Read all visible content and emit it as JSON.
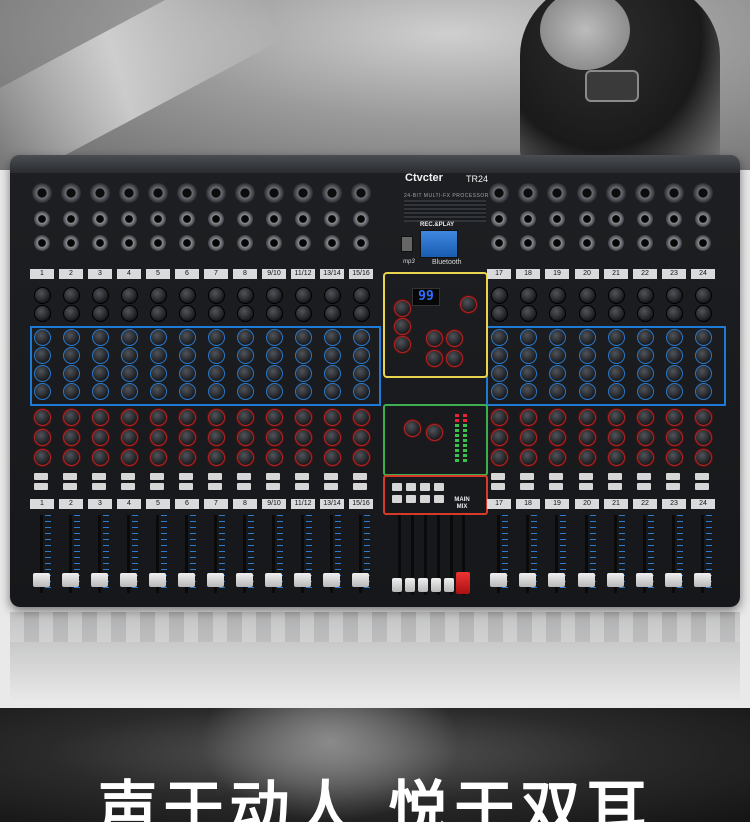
{
  "product": {
    "brand": "Ctvcter",
    "model": "TR24",
    "subtitle": "24-BIT MULTI-FX PROCESSOR",
    "rec_play": "REC.&PLAY",
    "mp3_label": "mp3",
    "bluetooth_label": "Bluetooth",
    "fx_display": "99",
    "main_mix_label": "MAIN MIX"
  },
  "channels": {
    "left": [
      "1",
      "2",
      "3",
      "4",
      "5",
      "6",
      "7",
      "8",
      "9/10",
      "11/12",
      "13/14",
      "15/16"
    ],
    "right": [
      "17",
      "18",
      "19",
      "20",
      "21",
      "22",
      "23",
      "24"
    ]
  },
  "banner": {
    "slogan": "声于动人 悦于双耳"
  },
  "colors": {
    "highlight_blue": "#1f7ad6",
    "highlight_yellow": "#e8d44d",
    "highlight_green": "#3fae4f",
    "highlight_red": "#d83a2a"
  }
}
